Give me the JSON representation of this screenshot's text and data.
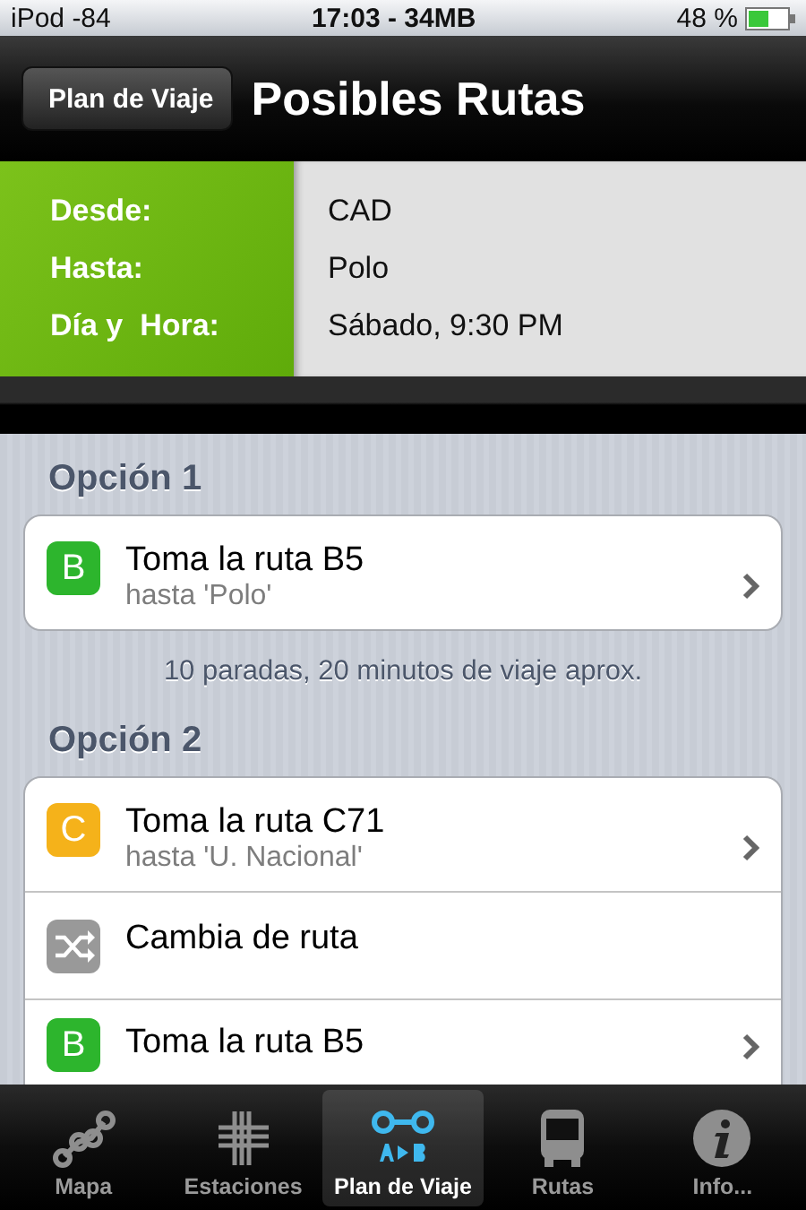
{
  "status_bar": {
    "carrier": "iPod -84",
    "center": "17:03 - 34MB",
    "battery": "48 %"
  },
  "nav_bar": {
    "back": "Plan de Viaje",
    "title": "Posibles Rutas"
  },
  "trip": [
    {
      "label": "Desde:",
      "value": "CAD"
    },
    {
      "label": "Hasta:",
      "value": "Polo"
    },
    {
      "label": "Día y  Hora:",
      "value": "Sábado, 9:30 PM"
    }
  ],
  "options": [
    {
      "title": "Opción 1",
      "steps": [
        {
          "kind": "route",
          "letter": "B",
          "color": "#2db52d",
          "title": "Toma la ruta B5",
          "subtitle": "hasta 'Polo'"
        }
      ],
      "summary": "10 paradas, 20 minutos de viaje aprox."
    },
    {
      "title": "Opción 2",
      "steps": [
        {
          "kind": "route",
          "letter": "C",
          "color": "#f5b21a",
          "title": "Toma la ruta C71",
          "subtitle": "hasta 'U. Nacional'"
        },
        {
          "kind": "transfer",
          "title": "Cambia de ruta"
        },
        {
          "kind": "route",
          "letter": "B",
          "color": "#2db52d",
          "title": "Toma la ruta B5"
        }
      ]
    }
  ],
  "tab_bar": [
    {
      "label": "Mapa",
      "kind": "map",
      "selected": false
    },
    {
      "label": "Estaciones",
      "kind": "stations",
      "selected": false
    },
    {
      "label": "Plan de Viaje",
      "kind": "plan",
      "selected": true
    },
    {
      "label": "Rutas",
      "kind": "bus",
      "selected": false
    },
    {
      "label": "Info...",
      "kind": "info",
      "selected": false
    }
  ]
}
